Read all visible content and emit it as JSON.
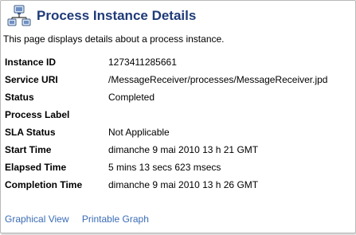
{
  "header": {
    "title": "Process Instance Details",
    "icon": "process-network-icon"
  },
  "intro": "This page displays details about a process instance.",
  "details": [
    {
      "label": "Instance ID",
      "value": "1273411285661"
    },
    {
      "label": "Service URI",
      "value": "/MessageReceiver/processes/MessageReceiver.jpd"
    },
    {
      "label": "Status",
      "value": "Completed"
    },
    {
      "label": "Process Label",
      "value": ""
    },
    {
      "label": "SLA Status",
      "value": "Not Applicable"
    },
    {
      "label": "Start Time",
      "value": "dimanche 9 mai 2010 13 h 21 GMT"
    },
    {
      "label": "Elapsed Time",
      "value": "5 mins 13 secs 623 msecs"
    },
    {
      "label": "Completion Time",
      "value": "dimanche 9 mai 2010 13 h 26 GMT"
    }
  ],
  "links": {
    "graphical_view": "Graphical View",
    "printable_graph": "Printable Graph"
  },
  "colors": {
    "title": "#1f3b78",
    "link": "#3a6cb5"
  }
}
